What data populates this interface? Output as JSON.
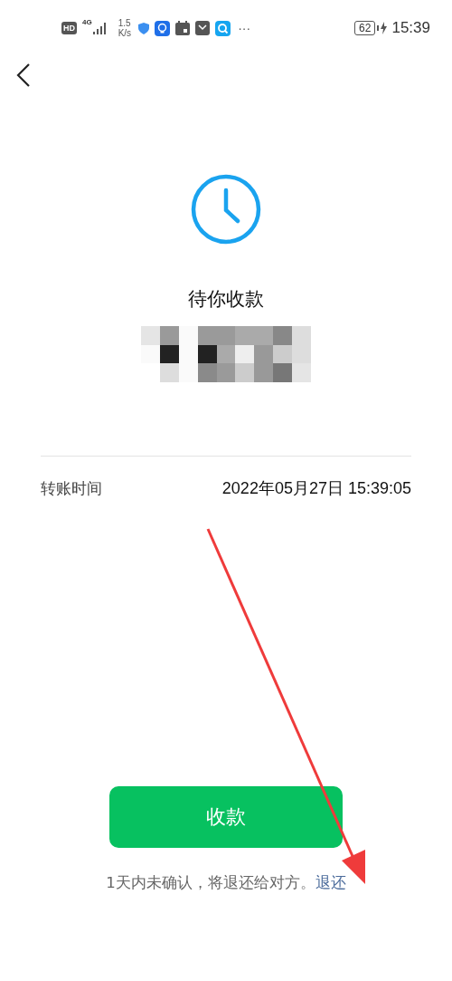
{
  "status_bar": {
    "hd": "HD",
    "network": "4G",
    "speed_value": "1.5",
    "speed_unit": "K/s",
    "more": "···",
    "battery": "62",
    "time": "15:39"
  },
  "title": "待你收款",
  "details": [
    {
      "label": "转账时间",
      "value": "2022年05月27日 15:39:05"
    }
  ],
  "primary_button": "收款",
  "note": {
    "text": "1天内未确认，将退还给对方。",
    "link": "退还"
  }
}
